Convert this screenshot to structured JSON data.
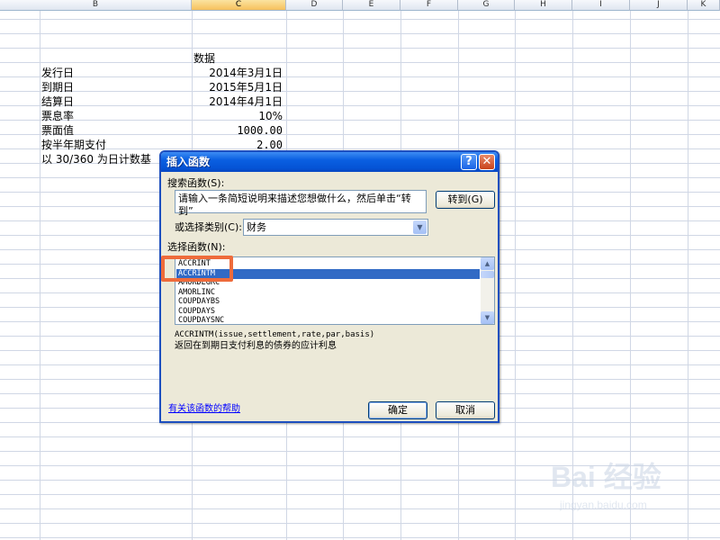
{
  "spreadsheet": {
    "columns": [
      "B",
      "C",
      "D",
      "E",
      "F",
      "G",
      "H",
      "I",
      "J",
      "K"
    ],
    "active_column": "C",
    "header_value": "数据",
    "rows": [
      {
        "label": "发行日",
        "value": "2014年3月1日"
      },
      {
        "label": "到期日",
        "value": "2015年5月1日"
      },
      {
        "label": "结算日",
        "value": "2014年4月1日"
      },
      {
        "label": "票息率",
        "value": "10%"
      },
      {
        "label": "票面值",
        "value": "1000.00"
      },
      {
        "label": "按半年期支付",
        "value": "2.00"
      },
      {
        "label": "以 30/360 为日计数基",
        "value": ""
      }
    ]
  },
  "dialog": {
    "title": "插入函数",
    "help_button": "?",
    "close_button": "✕",
    "search_label": "搜索函数(S):",
    "search_text": "请输入一条简短说明来描述您想做什么，然后单击“转到”",
    "goto_button": "转到(G)",
    "category_label": "或选择类别(C):",
    "category_value": "财务",
    "function_list_label": "选择函数(N):",
    "functions": [
      "ACCRINT",
      "ACCRINTM",
      "AMORDEGRC",
      "AMORLINC",
      "COUPDAYBS",
      "COUPDAYS",
      "COUPDAYSNC"
    ],
    "selected_function": "ACCRINTM",
    "signature": "ACCRINTM(issue,settlement,rate,par,basis)",
    "description": "返回在到期日支付利息的债券的应计利息",
    "help_link": "有关该函数的帮助",
    "ok_button": "确定",
    "cancel_button": "取消"
  },
  "watermark": {
    "brand": "Bai 经验",
    "sub": "jingyan.baidu.com"
  },
  "colors": {
    "titlebar": "#0554d6",
    "selection": "#316ac5",
    "highlight_box": "#ee6b3b",
    "dialog_bg": "#ece9d8",
    "grid_line": "#d0d7e5"
  }
}
